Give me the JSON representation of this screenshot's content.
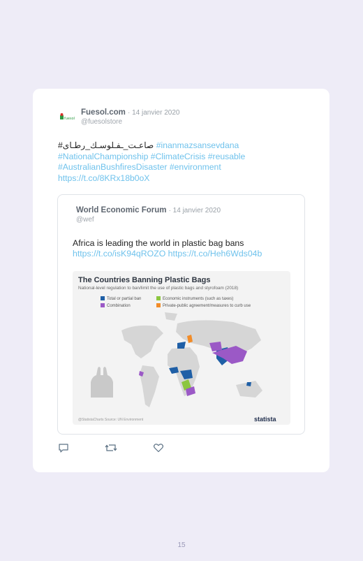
{
  "tweet": {
    "author_name": "Fuesol.com",
    "date": "· 14 janvier 2020",
    "handle": "@fuesolstore",
    "text_arabic": "#صاعـت_ـفـلوسـك_رطـاى ",
    "hashtag1": "#inanmazsansevdana",
    "line2": "#NationalChampionship #ClimateCrisis #reusable",
    "line3": "#AustralianBushfiresDisaster #environment",
    "link": "https://t.co/8KRx18b0oX"
  },
  "quote": {
    "author_name": "World Economic Forum",
    "date": "· 14 janvier 2020",
    "handle": "@wef",
    "text": "Africa is leading the world in plastic bag bans",
    "links": "https://t.co/isK94qROZO https://t.co/Heh6Wds04b"
  },
  "media": {
    "title": "The Countries Banning Plastic Bags",
    "subtitle": "National-level regulation to ban/limit the use of plastic bags and styrofoam (2018)",
    "legend": [
      {
        "label": "Total or partial ban",
        "color": "#1f5fa6"
      },
      {
        "label": "Economic instruments (such as taxes)",
        "color": "#8cc63f"
      },
      {
        "label": "Combination",
        "color": "#9b59c6"
      },
      {
        "label": "Private-public agreement/measures to curb use",
        "color": "#f28c28"
      }
    ],
    "source": "@StatistaCharts    Source: UN Environment",
    "logo": "statista"
  },
  "actions": {
    "reply": "reply-icon",
    "retweet": "retweet-icon",
    "like": "heart-icon"
  },
  "page_number": "15"
}
